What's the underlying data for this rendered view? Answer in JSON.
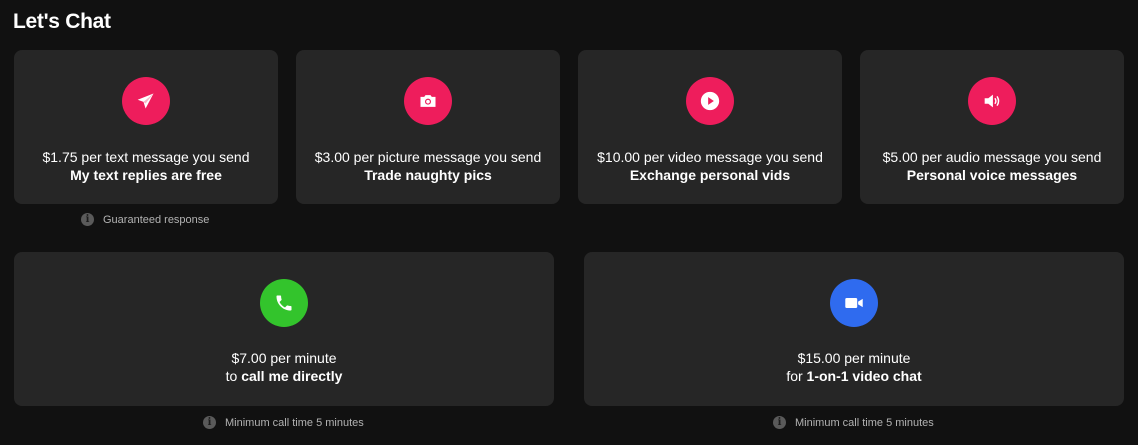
{
  "header": {
    "title": "Let's Chat"
  },
  "colors": {
    "pink": "#ee1d5c",
    "green": "#33c42c",
    "blue": "#2f6bef",
    "card": "#262626",
    "background": "#111111"
  },
  "options": [
    {
      "icon": "paper-plane-icon",
      "price": "$1.75 per text message you send",
      "detail": "My text replies are free"
    },
    {
      "icon": "camera-icon",
      "price": "$3.00 per picture message you send",
      "detail": "Trade naughty pics"
    },
    {
      "icon": "play-icon",
      "price": "$10.00 per video message you send",
      "detail": "Exchange personal vids"
    },
    {
      "icon": "speaker-icon",
      "price": "$5.00 per audio message you send",
      "detail": "Personal voice messages"
    }
  ],
  "notes": {
    "text": "Guaranteed response",
    "call": "Minimum call time 5 minutes",
    "video": "Minimum call time 5 minutes"
  },
  "calls": [
    {
      "icon": "phone-icon",
      "price": "$7.00 per minute",
      "prefix": "to ",
      "detail": "call me directly"
    },
    {
      "icon": "video-camera-icon",
      "price": "$15.00 per minute",
      "prefix": "for ",
      "detail": "1-on-1 video chat"
    }
  ]
}
